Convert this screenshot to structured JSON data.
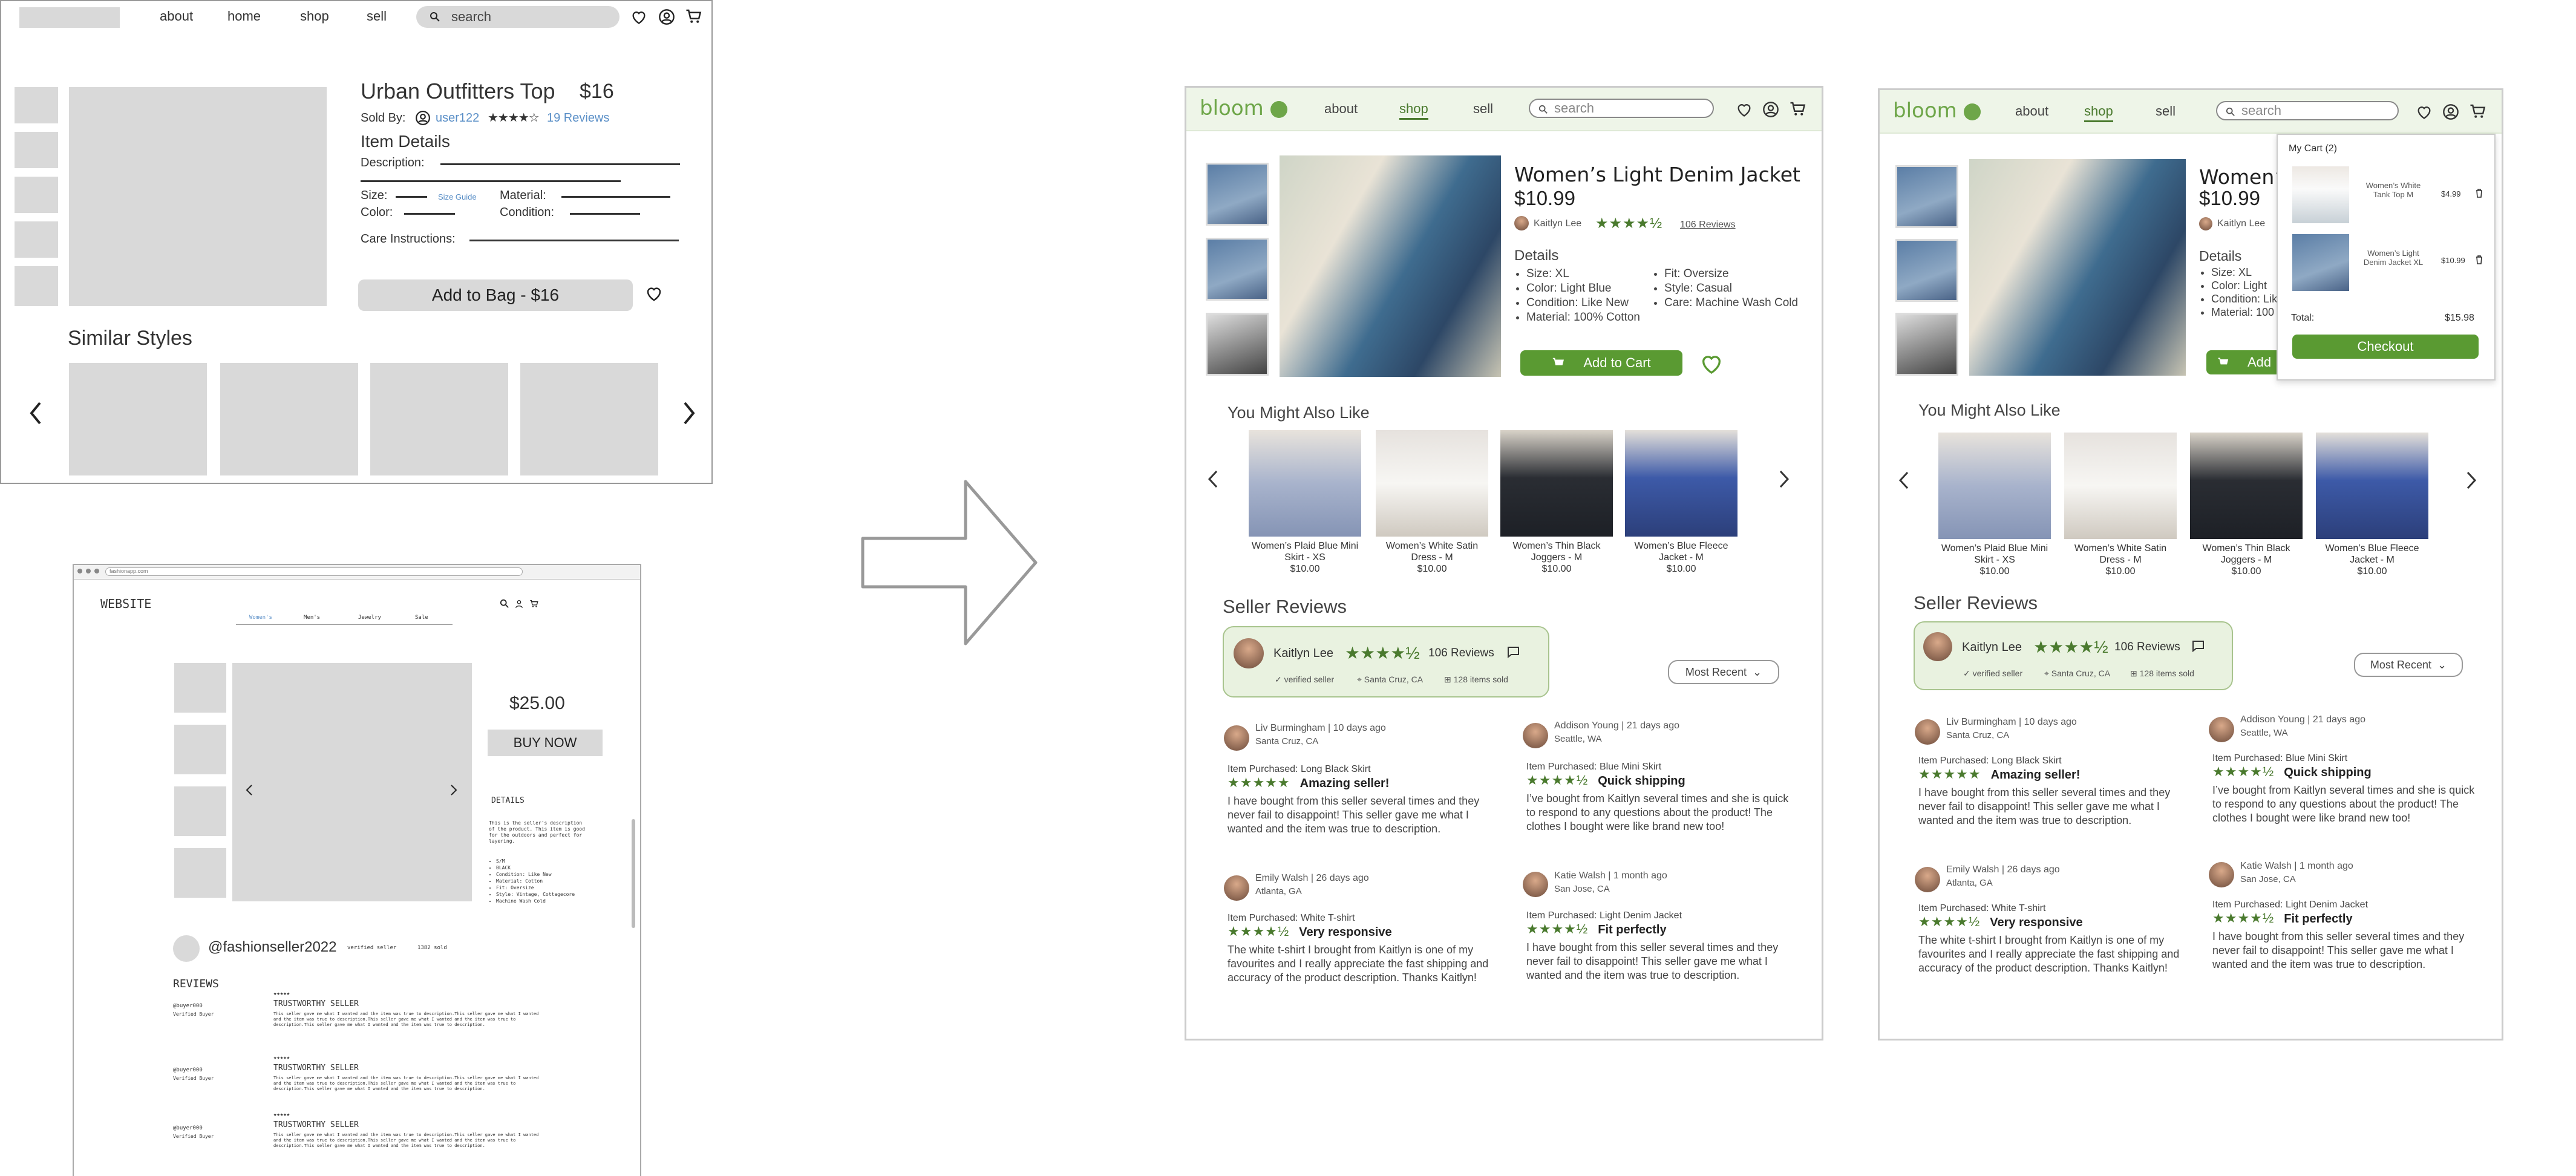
{
  "wf1": {
    "nav": [
      "about",
      "home",
      "shop",
      "sell"
    ],
    "search_placeholder": "search",
    "title": "Urban Outfitters Top",
    "price": "$16",
    "sold_by": "Sold By:",
    "user": "user122",
    "rating_stars": "★★★★☆",
    "reviews": "19 Reviews",
    "item_details": "Item Details",
    "description": "Description:",
    "size": "Size:",
    "size_guide": "Size Guide",
    "material": "Material:",
    "color": "Color:",
    "condition": "Condition:",
    "care": "Care Instructions:",
    "add_to_bag": "Add to Bag - $16",
    "similar": "Similar Styles"
  },
  "wf2": {
    "url": "fashionapp.com",
    "site": "WEBSITE",
    "tabs": [
      "Women's",
      "Men's",
      "Jewelry",
      "Sale"
    ],
    "price": "$25.00",
    "buy": "BUY NOW",
    "details": "DETAILS",
    "desc": "This is the seller's description of the product. This item is good for the outdoors and perfect for layering.",
    "bullets": [
      "S/M",
      "BLACK",
      "Condition: Like New",
      "Material: Cotton",
      "Fit: Oversize",
      "Style: Vintage, Cottagecore",
      "Machine Wash Cold"
    ],
    "seller": "@fashionseller2022",
    "verified": "verified seller",
    "sold": "1382 sold",
    "reviews": "REVIEWS",
    "review_list": [
      {
        "user": "@buyer000",
        "tag": "Verified Buyer",
        "stars": "★★★★★",
        "title": "TRUSTWORTHY SELLER",
        "body": "This seller gave me what I wanted and the item was true to description.This seller gave me what I wanted and the item was true to description.This seller gave me what I wanted and the item was true to description.This seller gave me what I wanted and the item was true to description."
      },
      {
        "user": "@buyer000",
        "tag": "Verified Buyer",
        "stars": "★★★★★",
        "title": "TRUSTWORTHY SELLER",
        "body": "This seller gave me what I wanted and the item was true to description.This seller gave me what I wanted and the item was true to description.This seller gave me what I wanted and the item was true to description.This seller gave me what I wanted and the item was true to description."
      },
      {
        "user": "@buyer000",
        "tag": "Verified Buyer",
        "stars": "★★★★★",
        "title": "TRUSTWORTHY SELLER",
        "body": "This seller gave me what I wanted and the item was true to description.This seller gave me what I wanted and the item was true to description.This seller gave me what I wanted and the item was true to description.This seller gave me what I wanted and the item was true to description."
      }
    ]
  },
  "m1": {
    "logo": "bloom",
    "nav": [
      "about",
      "shop",
      "sell"
    ],
    "search_placeholder": "search",
    "title": "Women’s Light Denim Jacket",
    "price": "$10.99",
    "seller": "Kaitlyn Lee",
    "stars": "★★★★½",
    "reviews": "106 Reviews",
    "details_label": "Details",
    "details_left": [
      "Size: XL",
      "Color: Light Blue",
      "Condition: Like New",
      "Material: 100% Cotton"
    ],
    "details_right": [
      "Fit: Oversize",
      "Style: Casual",
      "Care: Machine Wash Cold"
    ],
    "add_to_cart": "Add to Cart",
    "also_like": "You Might Also Like",
    "products": [
      {
        "name": "Women’s Plaid Blue Mini Skirt - XS",
        "price": "$10.00"
      },
      {
        "name": "Women’s White Satin Dress - M",
        "price": "$10.00"
      },
      {
        "name": "Women’s Thin Black Joggers - M",
        "price": "$10.00"
      },
      {
        "name": "Women’s Blue Fleece Jacket - M",
        "price": "$10.00"
      }
    ],
    "seller_reviews": "Seller Reviews",
    "seller_name": "Kaitlyn Lee",
    "seller_stars": "★★★★½",
    "seller_count": "106 Reviews",
    "verified": "verified seller",
    "location": "Santa Cruz, CA",
    "sold": "128 items sold",
    "sort": "Most Recent",
    "reviews_list": [
      {
        "who": "Liv Burmingham | 10 days ago",
        "loc": "Santa Cruz, CA",
        "item": "Item Purchased: Long Black Skirt",
        "stars": "★★★★★",
        "head": "Amazing seller!",
        "body": "I have bought from this seller several times and they never fail to disappoint! This seller gave me what I wanted and the item was true to description."
      },
      {
        "who": "Addison Young | 21 days ago",
        "loc": "Seattle, WA",
        "item": "Item Purchased: Blue Mini Skirt",
        "stars": "★★★★½",
        "head": "Quick shipping",
        "body": "I’ve bought from Kaitlyn several times and she is quick to respond to any questions about the product!  The clothes I bought were like brand new too!"
      },
      {
        "who": "Emily Walsh | 26 days ago",
        "loc": "Atlanta, GA",
        "item": "Item Purchased: White T-shirt",
        "stars": "★★★★½",
        "head": "Very responsive",
        "body": "The white t-shirt I brought from Kaitlyn is one of my favourites and I really appreciate the fast shipping and accuracy of the product description. Thanks Kaitlyn!"
      },
      {
        "who": "Katie Walsh | 1 month ago",
        "loc": "San Jose, CA",
        "item": "Item Purchased: Light Denim Jacket",
        "stars": "★★★★½",
        "head": "Fit perfectly",
        "body": "I have bought from this seller several times and they never fail to disappoint! This seller gave me what I wanted and the item was true to description."
      }
    ]
  },
  "m2": {
    "cart_title": "My Cart (2)",
    "cart_items": [
      {
        "name": "Women’s White Tank Top M",
        "price": "$4.99"
      },
      {
        "name": "Women’s Light Denim Jacket XL",
        "price": "$10.99"
      }
    ],
    "total_label": "Total:",
    "total": "$15.98",
    "checkout": "Checkout",
    "title_partial": "Women’",
    "add_partial": "Add",
    "details_partial": [
      "Size: XL",
      "Color: Light",
      "Condition: Lik",
      "Material: 100"
    ]
  },
  "colors": {
    "accent": "#5a9a32",
    "header_bg": "#eef5e8",
    "seller_box": "#e9f2e0"
  }
}
